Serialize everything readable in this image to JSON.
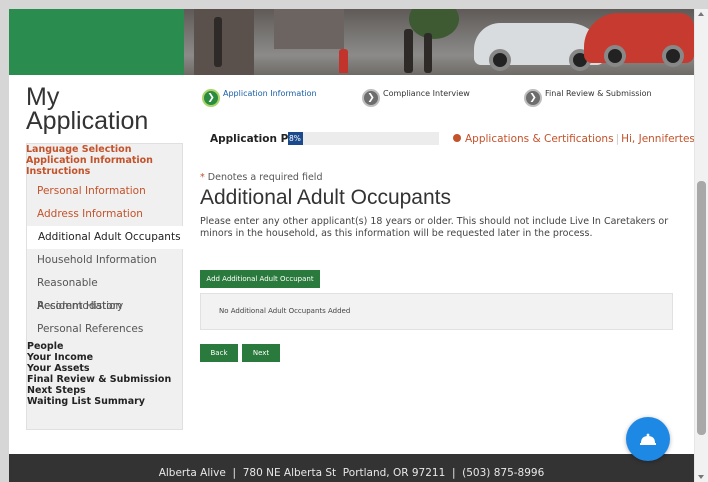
{
  "app_title": "My Application",
  "steps": [
    {
      "label": "Application Information",
      "state": "current"
    },
    {
      "label": "Compliance Interview",
      "state": "pending"
    },
    {
      "label": "Final Review & Submission",
      "state": "pending"
    }
  ],
  "progress": {
    "label": "Application Progress",
    "value_text": "8%",
    "fraction": 0.08
  },
  "header_links": {
    "applications": "Applications & Certifications",
    "user": "Hi, Jennifertest"
  },
  "sidebar": {
    "language": "Language Selection",
    "app_info": "Application Information Instructions",
    "sub_items": [
      {
        "label": "Personal Information",
        "style": "orange"
      },
      {
        "label": "Address Information",
        "style": "orange"
      },
      {
        "label": "Additional Adult Occupants",
        "style": "active"
      },
      {
        "label": "Household Information",
        "style": "normal"
      },
      {
        "label": "Reasonable Accommodation",
        "style": "normal"
      },
      {
        "label": "Resident History",
        "style": "normal"
      },
      {
        "label": "Personal References",
        "style": "normal"
      }
    ],
    "bottom_items": [
      "People",
      "Your Income",
      "Your Assets",
      "Final Review & Submission",
      "Next Steps",
      "Waiting List Summary"
    ]
  },
  "main": {
    "required_star": "*",
    "required_text": "Denotes a required field",
    "title": "Additional Adult Occupants",
    "description": "Please enter any other applicant(s) 18 years or older. This should not include Live In Caretakers or minors in the household, as this information will be requested later in the process.",
    "add_button": "Add Additional Adult Occupant",
    "empty_message": "No Additional Adult Occupants Added",
    "back_button": "Back",
    "next_button": "Next"
  },
  "footer": "Alberta Alive  |  780 NE Alberta St  Portland, OR 97211  |  (503) 875-8996",
  "colors": {
    "brand_green": "#2b8c4f",
    "accent_orange": "#c4522a",
    "chat_blue": "#1e88e5"
  },
  "icons": {
    "step_arrow": "chevron-right-icon",
    "caret": "caret-down-icon",
    "chat": "bell-icon"
  }
}
